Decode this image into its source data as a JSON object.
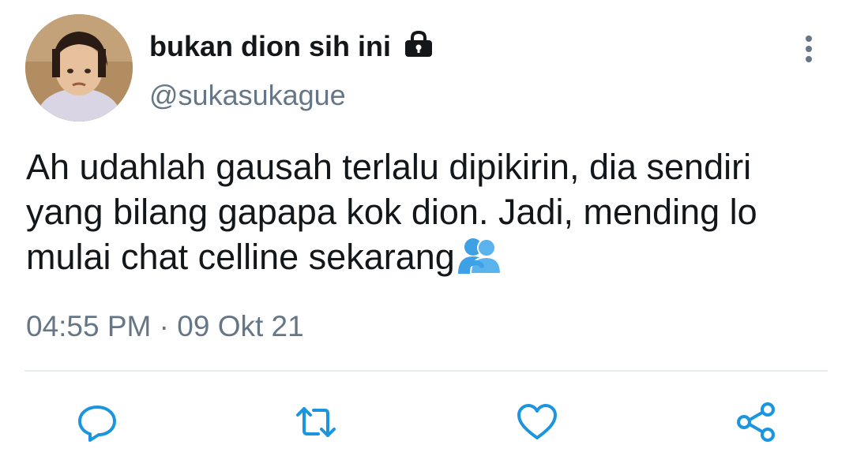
{
  "tweet": {
    "display_name": "bukan dion sih ini",
    "handle": "@sukasukague",
    "text": "Ah udahlah gausah terlalu dipikirin, dia sendiri yang bilang gapapa kok dion. Jadi, mending lo mulai chat celline sekarang",
    "time": "04:55 PM",
    "separator": "·",
    "date": "09 Okt 21",
    "protected": true,
    "emoji": "people-hugging-emoji"
  },
  "icons": {
    "lock": "lock-icon",
    "more": "more-vertical-icon",
    "reply": "reply-icon",
    "retweet": "retweet-icon",
    "like": "heart-icon",
    "share": "share-icon"
  },
  "colors": {
    "primary_text": "#14171a",
    "secondary_text": "#657786",
    "divider": "#e6ecf0",
    "action_icon": "#1b95e0",
    "emoji": "#3ea1e6"
  }
}
